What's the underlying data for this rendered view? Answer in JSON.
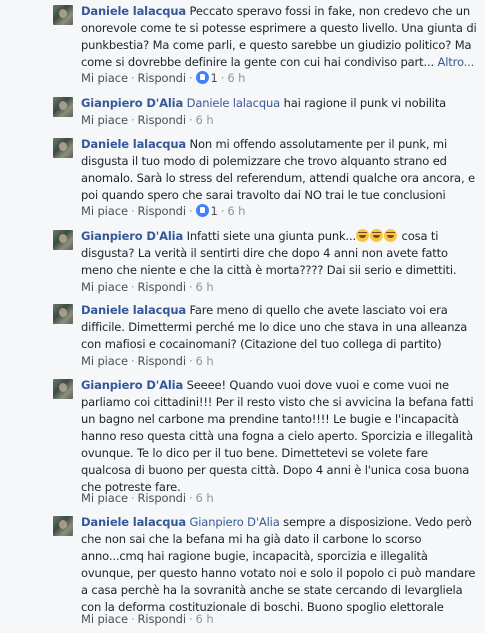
{
  "actions": {
    "like": "Mi piace",
    "reply": "Rispondi",
    "separator": "·"
  },
  "comments": [
    {
      "author": "Daniele lalacqua",
      "mention": "",
      "text": "Peccato speravo fossi in fake, non credevo che un onorevole come te si potesse esprimere a questo livello. Una giunta di punkbestia? Ma come parli, e questo sarebbe un giudizio politico? Ma come si dovrebbe definire la gente con cui hai condiviso part...",
      "more": "Altro...",
      "likes": "1",
      "time": "6 h"
    },
    {
      "author": "Gianpiero D'Alia",
      "mention": "Daniele lalacqua",
      "text": "hai ragione il punk vi nobilita",
      "time": "6 h"
    },
    {
      "author": "Daniele lalacqua",
      "mention": "",
      "text": "Non mi offendo assolutamente per il punk, mi disgusta il tuo modo di polemizzare che trovo alquanto strano ed anomalo. Sarà lo stress del referendum, attendi qualche ora ancora, e poi quando spero che sarai travolto dai NO trai le tue conclusioni",
      "likes": "1",
      "time": "6 h"
    },
    {
      "author": "Gianpiero D'Alia",
      "mention": "",
      "text_before": "Infatti siete una giunta punk...",
      "emoji": "face-with-tears-of-joy",
      "text": "cosa ti disgusta? La verità il sentirti dire che dopo 4 anni non avete fatto meno che niente e che la città è morta???? Dai sii serio e dimettiti.",
      "time": "6 h"
    },
    {
      "author": "Daniele lalacqua",
      "mention": "",
      "text": "Fare meno di quello che avete lasciato voi era difficile. Dimettermi perché me lo dice uno che stava in una alleanza con mafiosi e cocainomani? (Citazione del tuo collega di partito)",
      "time": "6 h"
    },
    {
      "author": "Gianpiero D'Alia",
      "mention": "",
      "text": "Seeee! Quando vuoi dove vuoi e come vuoi ne parliamo coi cittadini!!! Per il resto visto che si avvicina la befana fatti un bagno nel carbone ma prendine tanto!!!! Le bugie e l'incapacità hanno reso questa città una fogna a cielo aperto. Sporcizia e illegalità ovunque. Te lo dico per il tuo bene. Dimettetevi se volete fare qualcosa di buono per questa città. Dopo 4 anni è l'unica cosa buona che potreste fare.",
      "time": "6 h"
    },
    {
      "author": "Daniele lalacqua",
      "mention": "Gianpiero D'Alia",
      "text": "sempre a disposizione. Vedo però che non sai che la befana mi ha già dato il carbone lo scorso anno...cmq hai ragione bugie, incapacità, sporcizia e illegalità ovunque, per questo hanno votato noi e solo il popolo ci può mandare a casa perchè ha la sovranità anche se state cercando di levargliela con la deforma costituzionale di boschi. Buono spoglio elettorale",
      "time": "6 h"
    }
  ]
}
